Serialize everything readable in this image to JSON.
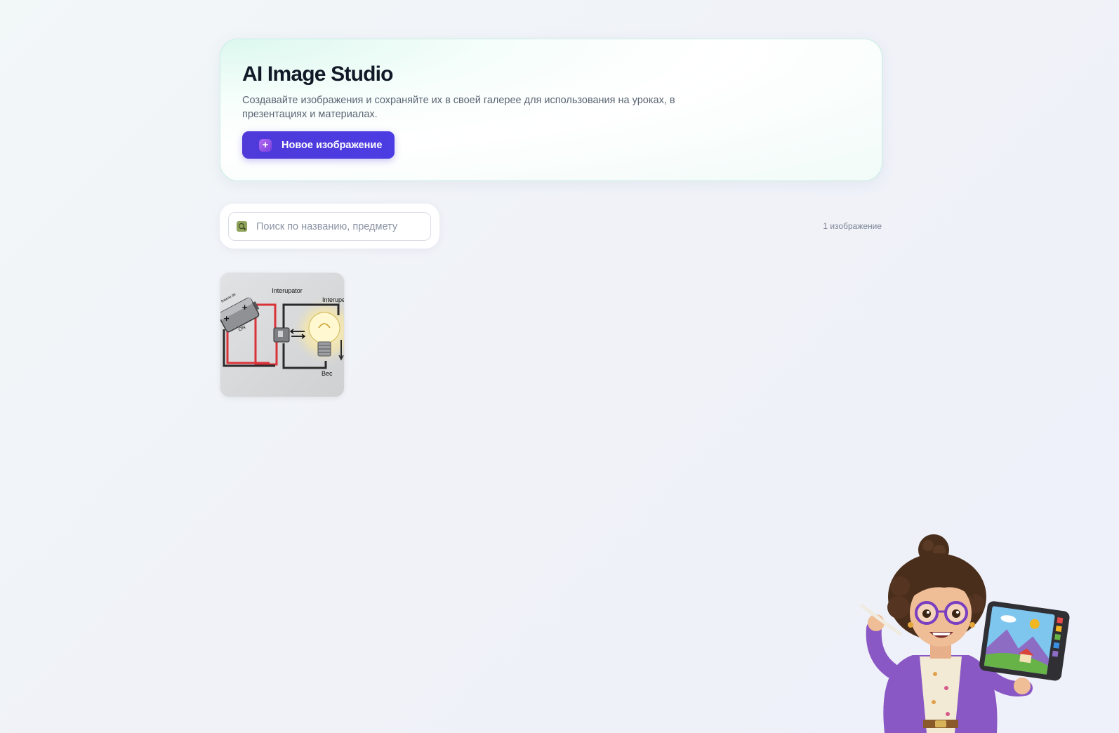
{
  "hero": {
    "title": "AI Image Studio",
    "description": "Создавайте изображения и сохраняйте их в своей галерее для использования на уроках, в презентациях и материалах.",
    "new_button_label": "Новое изображение"
  },
  "search": {
    "placeholder": "Поиск по названию, предмету",
    "value": ""
  },
  "gallery": {
    "count_label": "1 изображение",
    "items": [
      {
        "labels": {
          "top": "Interupator",
          "right": "Interupe",
          "battery": "Baterie 9V",
          "on": "ON",
          "bulb": "Bec"
        }
      }
    ]
  },
  "colors": {
    "primary": "#4f3ad9",
    "hero_border": "#c9eee4",
    "wire_red": "#d9333a",
    "wire_black": "#2b2b2b"
  },
  "icons": {
    "new_button": "plus-icon",
    "search": "search-icon"
  }
}
